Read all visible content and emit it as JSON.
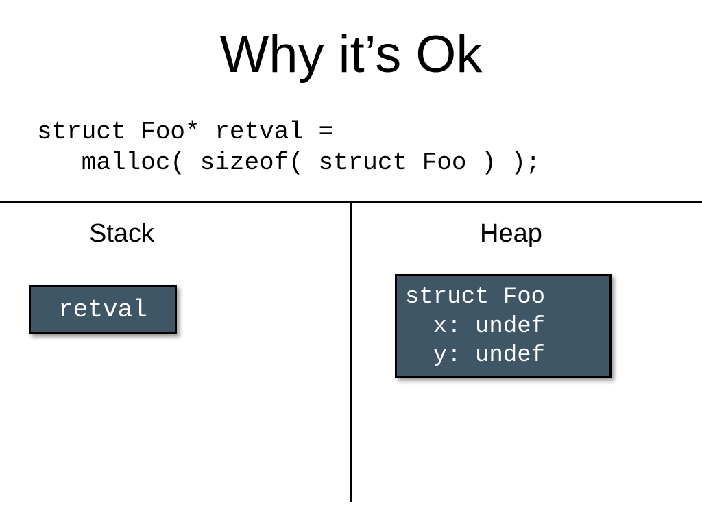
{
  "title": "Why it’s Ok",
  "code": {
    "line1": "struct Foo* retval =",
    "line2": "   malloc( sizeof( struct Foo ) );"
  },
  "columns": {
    "left_label": "Stack",
    "right_label": "Heap"
  },
  "stack_box": {
    "label": "retval"
  },
  "heap_box": {
    "line1": "struct Foo",
    "line2": "  x: undef",
    "line3": "  y: undef"
  }
}
